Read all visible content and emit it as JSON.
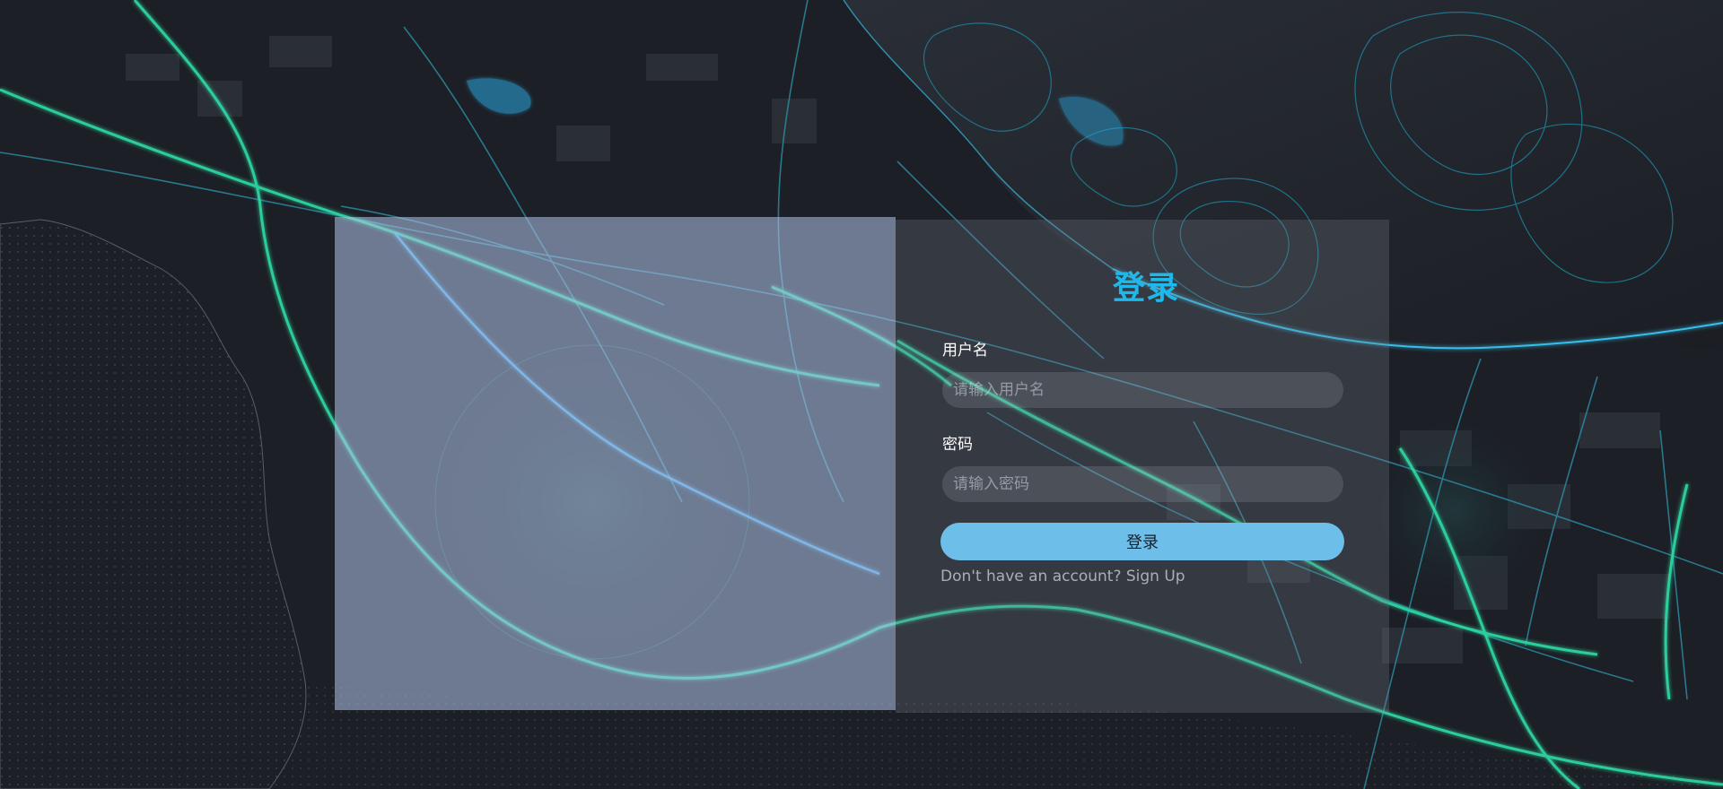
{
  "login": {
    "title": "登录",
    "username_label": "用户名",
    "username_placeholder": "请输入用户名",
    "password_label": "密码",
    "password_placeholder": "请输入密码",
    "submit_label": "登录",
    "signup_prompt": "Don't have an account?",
    "signup_link": "Sign Up"
  },
  "colors": {
    "title": "#1fb8ea",
    "button": "#6dbfe9",
    "road_primary": "#2fe0a8",
    "road_secondary": "#2d8fa8",
    "water_glow": "#3ad0ff"
  },
  "background": {
    "icon": "city-map-background"
  }
}
